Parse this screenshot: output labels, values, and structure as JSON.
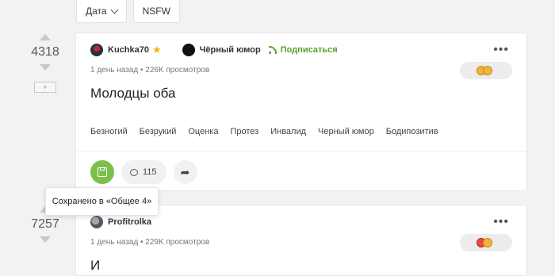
{
  "filters": {
    "date_label": "Дата",
    "nsfw_label": "NSFW"
  },
  "post1": {
    "rating": "4318",
    "plus_label": "+",
    "author": "Kuchka70",
    "community": "Чёрный юмор",
    "subscribe_label": "Подписаться",
    "meta": "1 день назад • 226K просмотров",
    "title": "Молодцы оба",
    "tags": [
      "Безногий",
      "Безрукий",
      "Оценка",
      "Протез",
      "Инвалид",
      "Черный юмор",
      "Бодипозитив"
    ],
    "comments_count": "115",
    "more_label": "•••"
  },
  "tooltip": {
    "text": "Сохранено в «Общее 4»"
  },
  "post2": {
    "rating": "7257",
    "author": "Profitrolka",
    "meta": "1 день назад • 229K просмотров",
    "title_partial": "И",
    "more_label": "•••"
  },
  "colors": {
    "accent_green": "#7cc04a",
    "subscribe_green": "#5aa02c",
    "star": "#f5b400"
  }
}
